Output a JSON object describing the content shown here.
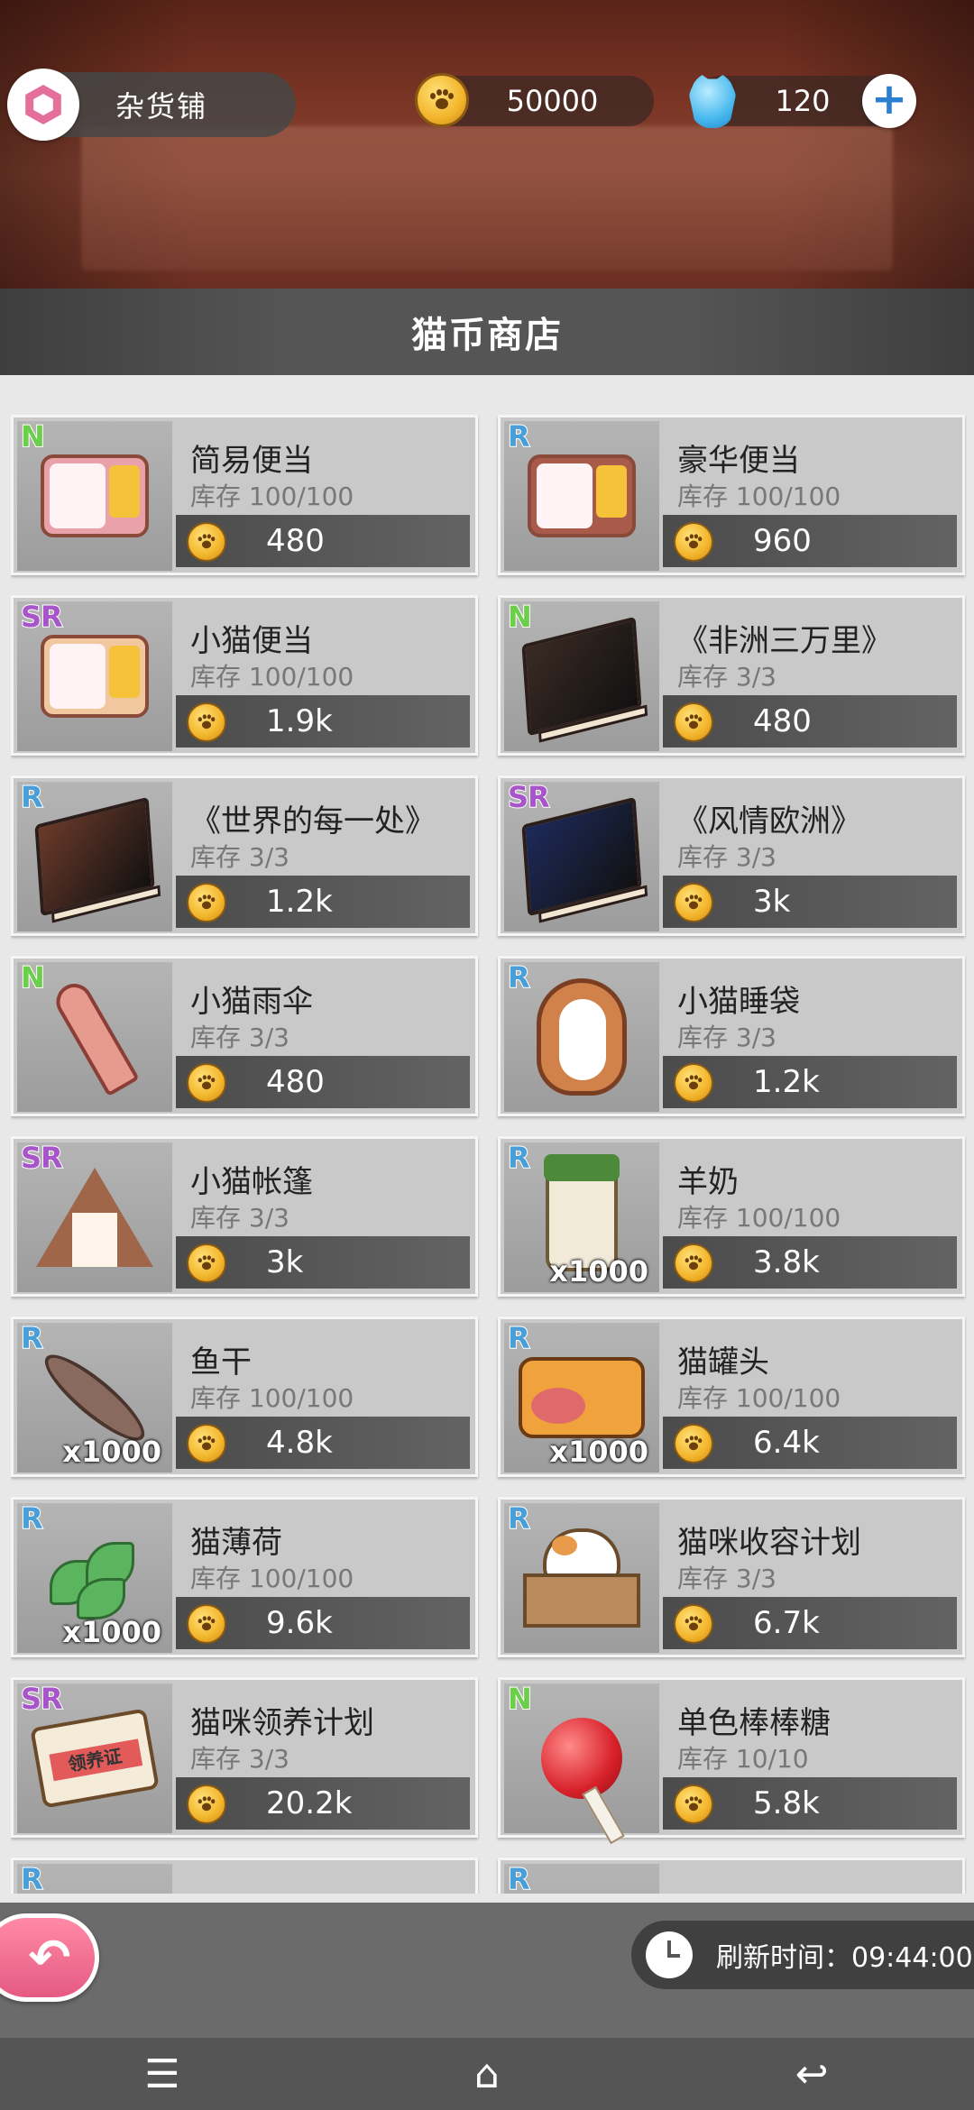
{
  "header": {
    "shop_name": "杂货铺",
    "coins": "50000",
    "gems": "120",
    "plus_label": "+"
  },
  "title": "猫币商店",
  "items": [
    {
      "rarity": "N",
      "name": "简易便当",
      "stock": "库存 100/100",
      "price": "480",
      "qty": "",
      "icon": "bento-icon"
    },
    {
      "rarity": "R",
      "name": "豪华便当",
      "stock": "库存 100/100",
      "price": "960",
      "qty": "",
      "icon": "deluxe-bento-icon"
    },
    {
      "rarity": "SR",
      "name": "小猫便当",
      "stock": "库存 100/100",
      "price": "1.9k",
      "qty": "",
      "icon": "cat-bento-icon"
    },
    {
      "rarity": "N",
      "name": "《非洲三万里》",
      "stock": "库存 3/3",
      "price": "480",
      "qty": "",
      "icon": "book-icon"
    },
    {
      "rarity": "R",
      "name": "《世界的每一处》",
      "stock": "库存 3/3",
      "price": "1.2k",
      "qty": "",
      "icon": "book-icon"
    },
    {
      "rarity": "SR",
      "name": "《风情欧洲》",
      "stock": "库存 3/3",
      "price": "3k",
      "qty": "",
      "icon": "book-icon"
    },
    {
      "rarity": "N",
      "name": "小猫雨伞",
      "stock": "库存 3/3",
      "price": "480",
      "qty": "",
      "icon": "umbrella-icon"
    },
    {
      "rarity": "R",
      "name": "小猫睡袋",
      "stock": "库存 3/3",
      "price": "1.2k",
      "qty": "",
      "icon": "sleeping-bag-icon"
    },
    {
      "rarity": "SR",
      "name": "小猫帐篷",
      "stock": "库存 3/3",
      "price": "3k",
      "qty": "",
      "icon": "tent-icon"
    },
    {
      "rarity": "R",
      "name": "羊奶",
      "stock": "库存 100/100",
      "price": "3.8k",
      "qty": "x1000",
      "icon": "milk-icon"
    },
    {
      "rarity": "R",
      "name": "鱼干",
      "stock": "库存 100/100",
      "price": "4.8k",
      "qty": "x1000",
      "icon": "dried-fish-icon"
    },
    {
      "rarity": "R",
      "name": "猫罐头",
      "stock": "库存 100/100",
      "price": "6.4k",
      "qty": "x1000",
      "icon": "cat-can-icon"
    },
    {
      "rarity": "R",
      "name": "猫薄荷",
      "stock": "库存 100/100",
      "price": "9.6k",
      "qty": "x1000",
      "icon": "catnip-icon"
    },
    {
      "rarity": "R",
      "name": "猫咪收容计划",
      "stock": "库存 3/3",
      "price": "6.7k",
      "qty": "",
      "icon": "cat-box-icon"
    },
    {
      "rarity": "SR",
      "name": "猫咪领养计划",
      "stock": "库存 3/3",
      "price": "20.2k",
      "qty": "",
      "icon": "adoption-tag-icon"
    },
    {
      "rarity": "N",
      "name": "单色棒棒糖",
      "stock": "库存 10/10",
      "price": "5.8k",
      "qty": "",
      "icon": "lollipop-icon"
    }
  ],
  "adoption_tag_text": "领养证",
  "partial_row": [
    {
      "rarity": "R"
    },
    {
      "rarity": "R"
    }
  ],
  "footer": {
    "back_icon": "back-arrow-icon",
    "refresh_label": "刷新时间：09:44:00"
  },
  "navbar": {
    "menu_glyph": "☰",
    "home_glyph": "⌂",
    "back_glyph": "↩"
  }
}
